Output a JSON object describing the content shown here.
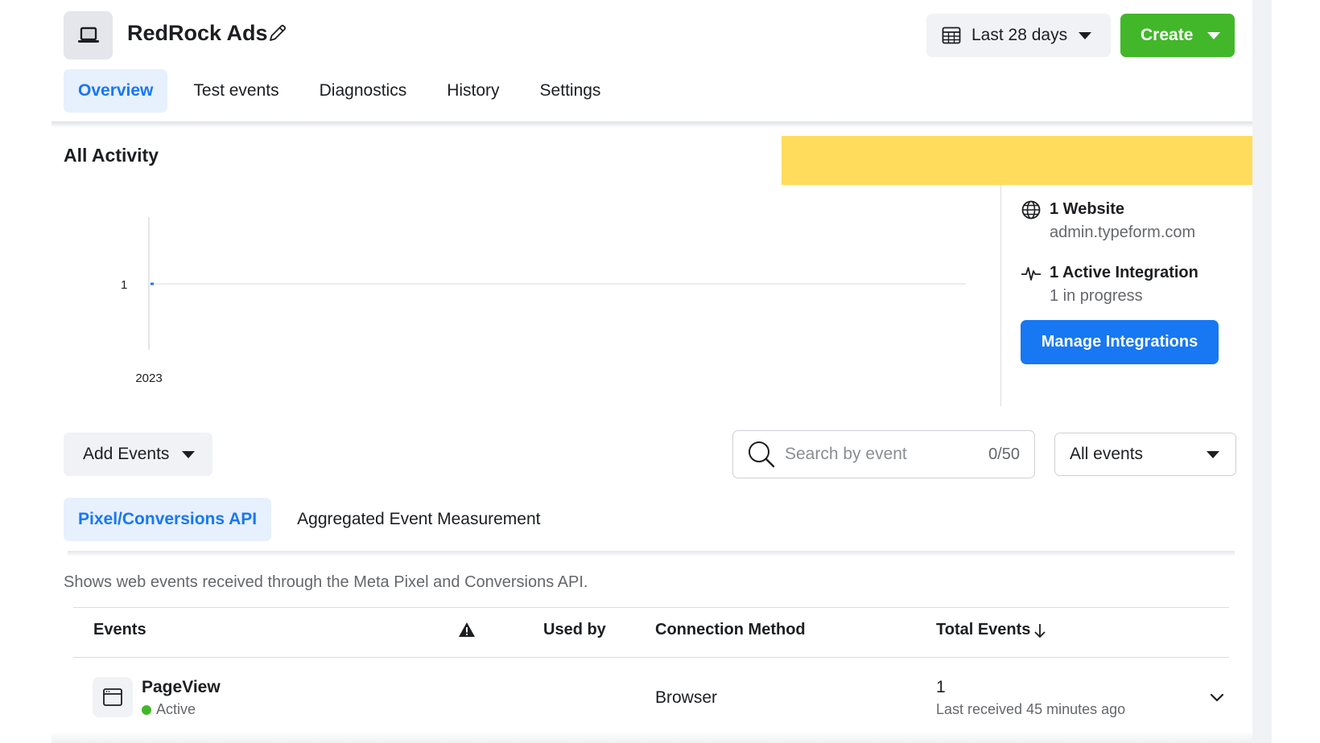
{
  "header": {
    "title": "RedRock Ads",
    "date_range_label": "Last 28 days",
    "create_label": "Create"
  },
  "tabs": [
    {
      "label": "Overview",
      "active": true
    },
    {
      "label": "Test events",
      "active": false
    },
    {
      "label": "Diagnostics",
      "active": false
    },
    {
      "label": "History",
      "active": false
    },
    {
      "label": "Settings",
      "active": false
    }
  ],
  "activity": {
    "title": "All Activity",
    "banner_color": "#ffdc5c",
    "chart_data": {
      "type": "line",
      "x": [
        "2023"
      ],
      "series": [
        {
          "values": [
            1
          ]
        }
      ],
      "y_tick_labels": [
        "1"
      ],
      "x_tick_labels": [
        "2023"
      ]
    }
  },
  "info": {
    "website_title": "1 Website",
    "website_domain": "admin.typeform.com",
    "integration_title": "1 Active Integration",
    "integration_status": "1 in progress",
    "manage_label": "Manage Integrations"
  },
  "toolbar": {
    "add_events_label": "Add Events",
    "search_placeholder": "Search by event",
    "search_value": "",
    "search_counter": "0/50",
    "filter_selected": "All events"
  },
  "subtabs": [
    {
      "label": "Pixel/Conversions API",
      "active": true
    },
    {
      "label": "Aggregated Event Measurement",
      "active": false
    }
  ],
  "description": "Shows web events received through the Meta Pixel and Conversions API.",
  "table": {
    "columns": {
      "events": "Events",
      "used_by": "Used by",
      "connection_method": "Connection Method",
      "total_events": "Total Events"
    },
    "rows": [
      {
        "name": "PageView",
        "status": "Active",
        "connection_method": "Browser",
        "total": "1",
        "last_received": "Last received 45 minutes ago"
      }
    ]
  },
  "colors": {
    "primary": "#1877f2",
    "create_green": "#42b72a",
    "active_dot": "#42b72a"
  }
}
